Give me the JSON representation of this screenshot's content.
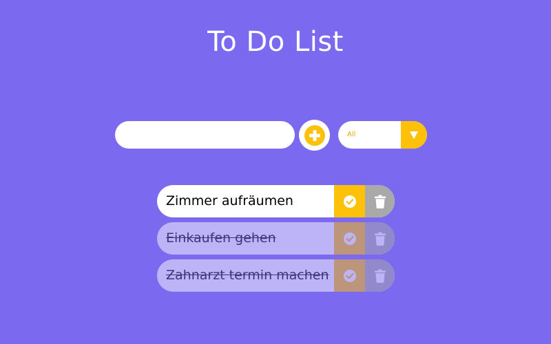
{
  "app": {
    "title": "To Do List"
  },
  "form": {
    "input_value": "",
    "input_placeholder": "",
    "add_icon": "plus-circle-icon",
    "filter": {
      "selected": "All",
      "arrow_icon": "caret-down-icon"
    }
  },
  "todos": [
    {
      "text": "Zimmer aufräumen",
      "completed": false
    },
    {
      "text": "Einkaufen gehen",
      "completed": true
    },
    {
      "text": "Zahnarzt termin machen",
      "completed": true
    }
  ],
  "icons": {
    "complete": "check-circle-icon",
    "delete": "trash-icon"
  },
  "colors": {
    "background": "#7b69ef",
    "accent": "#fec10a",
    "delete": "#a9a9a9",
    "surface": "#ffffff",
    "text": "#000000"
  }
}
